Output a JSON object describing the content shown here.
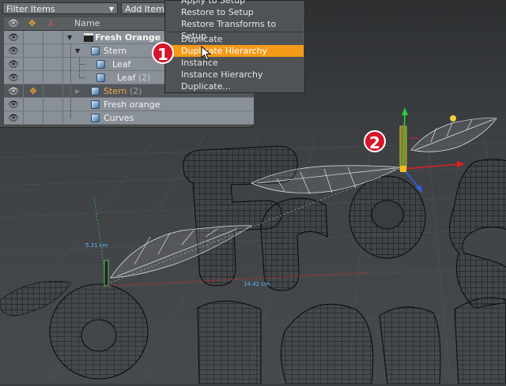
{
  "toolbar": {
    "filter_label": "Filter Items",
    "add_item_label": "Add Item"
  },
  "header": {
    "name_col": "Name"
  },
  "items": [
    {
      "name": "Fresh Orange st",
      "suffix": "",
      "bold": true
    },
    {
      "name": "Stern",
      "suffix": ""
    },
    {
      "name": "Leaf",
      "suffix": ""
    },
    {
      "name": "Leaf",
      "suffix": "(2)"
    },
    {
      "name": "Stern",
      "suffix": "(2)",
      "selected": true
    },
    {
      "name": "Fresh orange",
      "suffix": ""
    },
    {
      "name": "Curves",
      "suffix": ""
    }
  ],
  "context_menu": {
    "items": [
      {
        "label": "Apply to Setup"
      },
      {
        "label": "Restore to Setup"
      },
      {
        "label": "Restore Transforms to Setup"
      },
      {
        "label": "Duplicate"
      },
      {
        "label": "Duplicate Hierarchy",
        "highlighted": true
      },
      {
        "label": "Instance"
      },
      {
        "label": "Instance Hierarchy"
      },
      {
        "label": "Duplicate..."
      }
    ]
  },
  "callouts": [
    {
      "number": "1"
    },
    {
      "number": "2"
    }
  ],
  "measurements": {
    "vertical": "5.31 cm",
    "horizontal": "14.42 cm"
  },
  "colors": {
    "highlight": "#f39a19",
    "badge": "#d3162a",
    "selected_text": "#f2a84a",
    "measure": "#63b7ff"
  }
}
